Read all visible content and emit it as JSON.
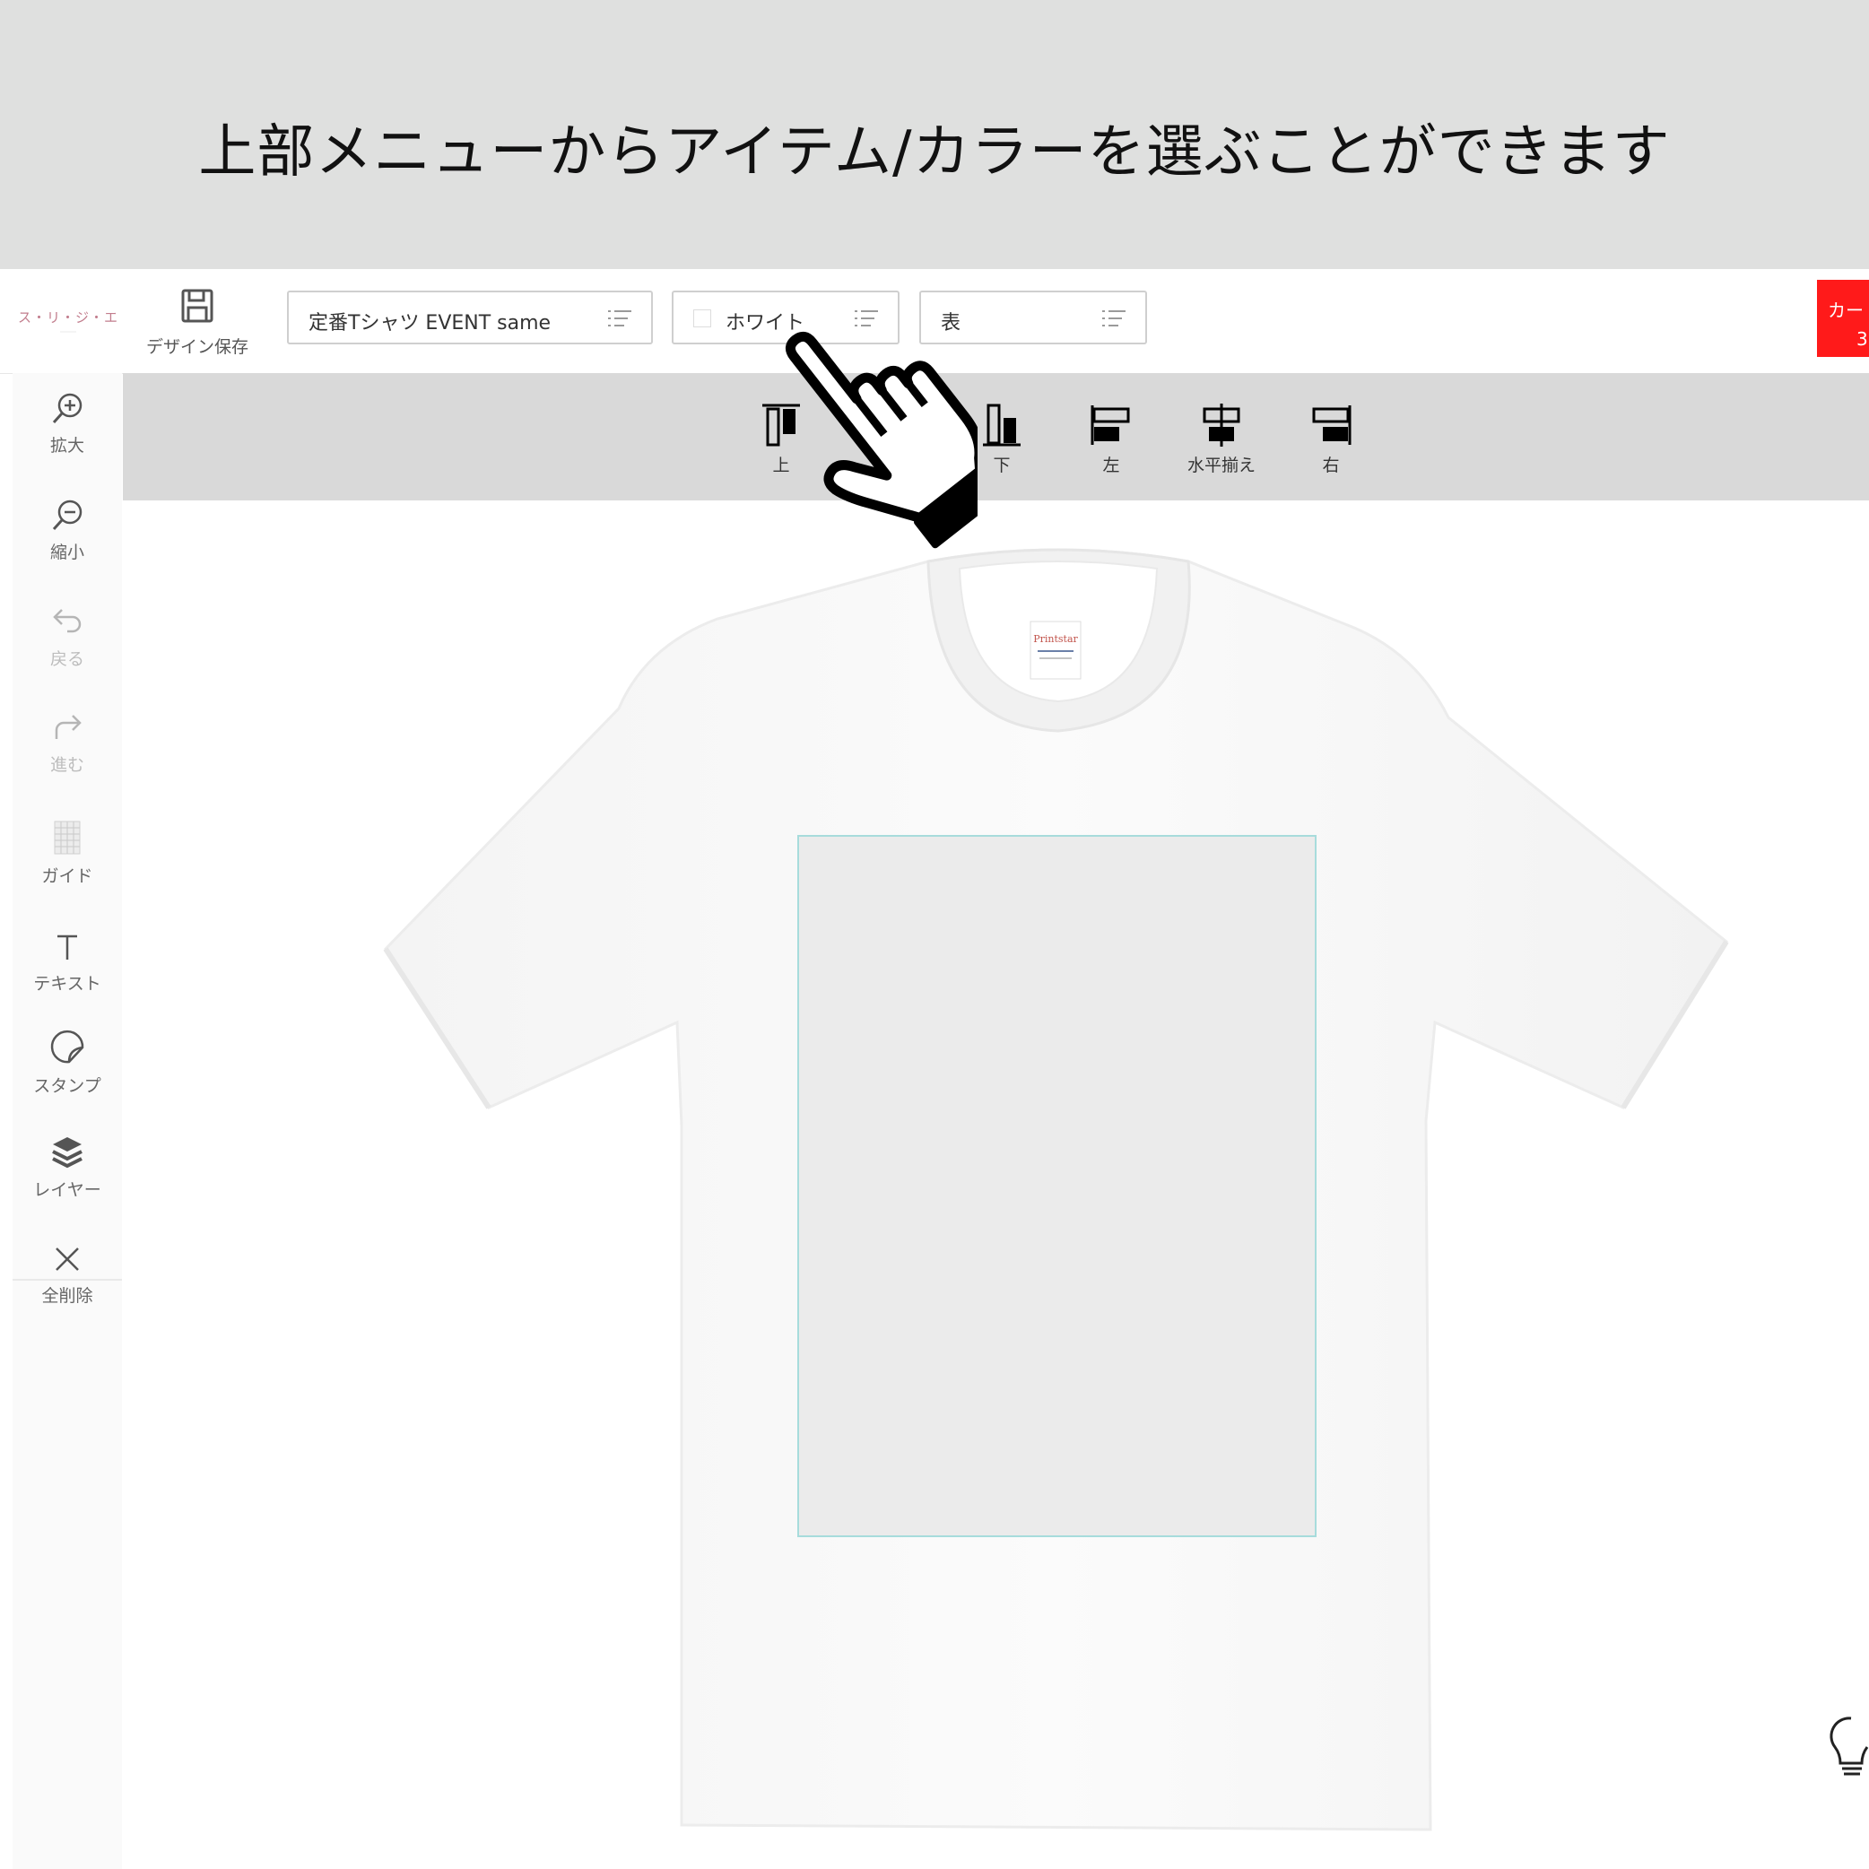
{
  "banner": {
    "text": "上部メニューからアイテム/カラーを選ぶことができます"
  },
  "header": {
    "logo_text": "ス・リ・ジ・エ",
    "save_label": "デザイン保存",
    "item_select": {
      "value": "定番Tシャツ EVENT same",
      "icon": "list-icon"
    },
    "color_select": {
      "value": "ホワイト",
      "swatch_color": "#ffffff",
      "icon": "list-icon"
    },
    "side_select": {
      "value": "表",
      "icon": "list-icon"
    },
    "cart_button": {
      "label": "カート",
      "count": "3",
      "color": "#ff1a1a"
    }
  },
  "sidebar": {
    "items": [
      {
        "label": "拡大",
        "icon": "zoom-in-icon",
        "enabled": true
      },
      {
        "label": "縮小",
        "icon": "zoom-out-icon",
        "enabled": true
      },
      {
        "label": "戻る",
        "icon": "undo-icon",
        "enabled": false
      },
      {
        "label": "進む",
        "icon": "redo-icon",
        "enabled": false
      },
      {
        "label": "ガイド",
        "icon": "grid-icon",
        "enabled": true
      },
      {
        "label": "テキスト",
        "icon": "text-icon",
        "enabled": true
      },
      {
        "label": "スタンプ",
        "icon": "sticker-icon",
        "enabled": true
      },
      {
        "label": "レイヤー",
        "icon": "layers-icon",
        "enabled": true
      },
      {
        "label": "全削除",
        "icon": "close-icon",
        "enabled": true
      }
    ]
  },
  "align_toolbar": {
    "items": [
      {
        "label": "上",
        "icon": "align-top-icon"
      },
      {
        "label": "下",
        "icon": "align-bottom-icon"
      },
      {
        "label": "左",
        "icon": "align-left-icon"
      },
      {
        "label": "水平揃え",
        "icon": "align-horizontal-center-icon"
      },
      {
        "label": "右",
        "icon": "align-right-icon"
      }
    ]
  },
  "canvas": {
    "product": "white t-shirt",
    "print_area_border_color": "#a7dcdc",
    "hint_icon": "lightbulb-icon"
  },
  "overlay": {
    "pointer": "hand-pointer-icon"
  }
}
